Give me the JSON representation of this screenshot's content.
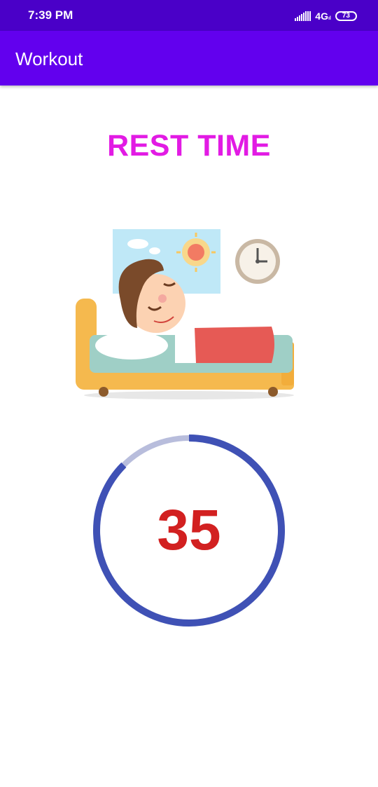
{
  "status_bar": {
    "time": "7:39 PM",
    "network": "4G",
    "battery": "73"
  },
  "app_bar": {
    "title": "Workout"
  },
  "rest": {
    "title": "REST TIME"
  },
  "timer": {
    "value": "35",
    "progress": 0.875,
    "colors": {
      "progress": "#3f51b5",
      "track": "#b8bddc",
      "text": "#d22020"
    }
  },
  "illustration": {
    "icons": [
      "sun-icon",
      "clock-icon",
      "bed-icon",
      "sleeping-child-icon"
    ]
  },
  "colors": {
    "status_bar": "#4a00c8",
    "app_bar": "#6200ee",
    "rest_title": "#e21be4"
  }
}
